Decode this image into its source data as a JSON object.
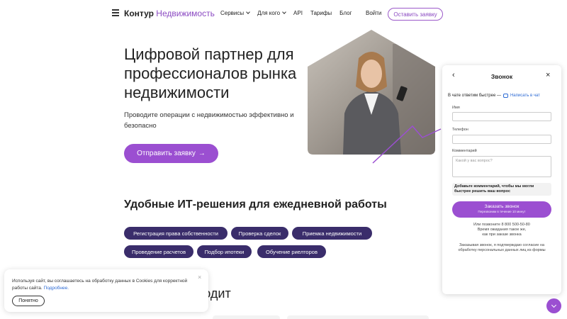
{
  "header": {
    "logo_brand": "Контур",
    "logo_product": "Недвижимость",
    "nav": [
      {
        "label": "Сервисы",
        "has_dropdown": true
      },
      {
        "label": "Для кого",
        "has_dropdown": true
      },
      {
        "label": "API",
        "has_dropdown": false
      },
      {
        "label": "Тарифы",
        "has_dropdown": false
      },
      {
        "label": "Блог",
        "has_dropdown": false
      }
    ],
    "login": "Войти",
    "apply": "Оставить заявку"
  },
  "hero": {
    "title": "Цифровой партнер для профессионалов рынка недвижимости",
    "subtitle": "Проводите операции с недвижимостью эффективно и безопасно",
    "button": "Отправить заявку",
    "button_arrow": "→"
  },
  "solutions": {
    "title": "Удобные ИТ-решения для ежедневной работы",
    "tags": [
      "Регистрация права собственности",
      "Проверка сделок",
      "Приемка недвижимости",
      "Проведение расчетов",
      "Подбор ипотеки",
      "Обучение риелторов"
    ]
  },
  "section2_partial_title": "дходит",
  "cookie": {
    "text": "Используя сайт, вы соглашаетесь на обработку данных в Cookies для корректной работы сайта.",
    "link": "Подробнее.",
    "close": "×",
    "button": "Понятно"
  },
  "call_panel": {
    "back": "‹",
    "title": "Звонок",
    "close": "×",
    "chat_prefix": "В чате ответим быстрее —",
    "chat_link": "Написать в чат",
    "name_label": "Имя",
    "phone_label": "Телефон",
    "comment_label": "Комментарий",
    "comment_placeholder": "Какой у вас вопрос?",
    "hint": "Добавьте комментарий, чтобы мы могли быстрее решить ваш вопрос",
    "order_button": "Заказать звонок",
    "order_button_sub": "Перезвоним в течение 10 минут",
    "phone_line1": "Или позвоните 8 800 500-50-80",
    "phone_line2": "Время ожидания такое же,",
    "phone_line3": "как при заказе звонка",
    "consent": "Заказывая звонок, я подтверждаю согласие на обработку персональных данных лиц из формы"
  },
  "colors": {
    "accent": "#9b4fd1",
    "tag_bg": "#3a2d6b",
    "link": "#2d6bd4"
  }
}
